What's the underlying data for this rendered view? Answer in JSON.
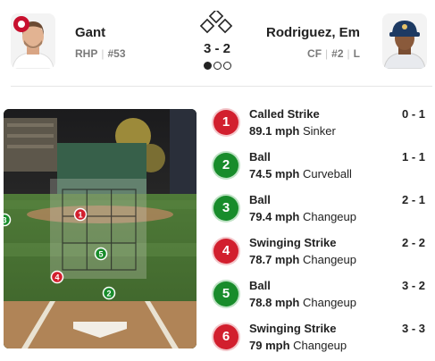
{
  "pitcher": {
    "name": "Gant",
    "position": "RHP",
    "number": "#53",
    "avatar_icon": "pitcher-headshot-icon"
  },
  "batter": {
    "name": "Rodriguez, Em",
    "position": "CF",
    "number": "#2",
    "bats": "L",
    "avatar_icon": "batter-headshot-icon"
  },
  "count": {
    "balls": 3,
    "strikes": 2,
    "display": "3 - 2",
    "outs": 1,
    "outs_max": 3,
    "bases_icon": "bases-diamond-icon"
  },
  "colors": {
    "strike": "#d21f2e",
    "ball": "#188c2b"
  },
  "pitches": [
    {
      "number": "1",
      "result": "Called Strike",
      "speed": "89.1 mph",
      "type": "Sinker",
      "count": "0 - 1",
      "kind": "strike"
    },
    {
      "number": "2",
      "result": "Ball",
      "speed": "74.5 mph",
      "type": "Curveball",
      "count": "1 - 1",
      "kind": "ball"
    },
    {
      "number": "3",
      "result": "Ball",
      "speed": "79.4 mph",
      "type": "Changeup",
      "count": "2 - 1",
      "kind": "ball"
    },
    {
      "number": "4",
      "result": "Swinging Strike",
      "speed": "78.7 mph",
      "type": "Changeup",
      "count": "2 - 2",
      "kind": "strike"
    },
    {
      "number": "5",
      "result": "Ball",
      "speed": "78.8 mph",
      "type": "Changeup",
      "count": "3 - 2",
      "kind": "ball"
    },
    {
      "number": "6",
      "result": "Swinging Strike",
      "speed": "79 mph",
      "type": "Changeup",
      "count": "3 - 3",
      "kind": "strike"
    }
  ]
}
